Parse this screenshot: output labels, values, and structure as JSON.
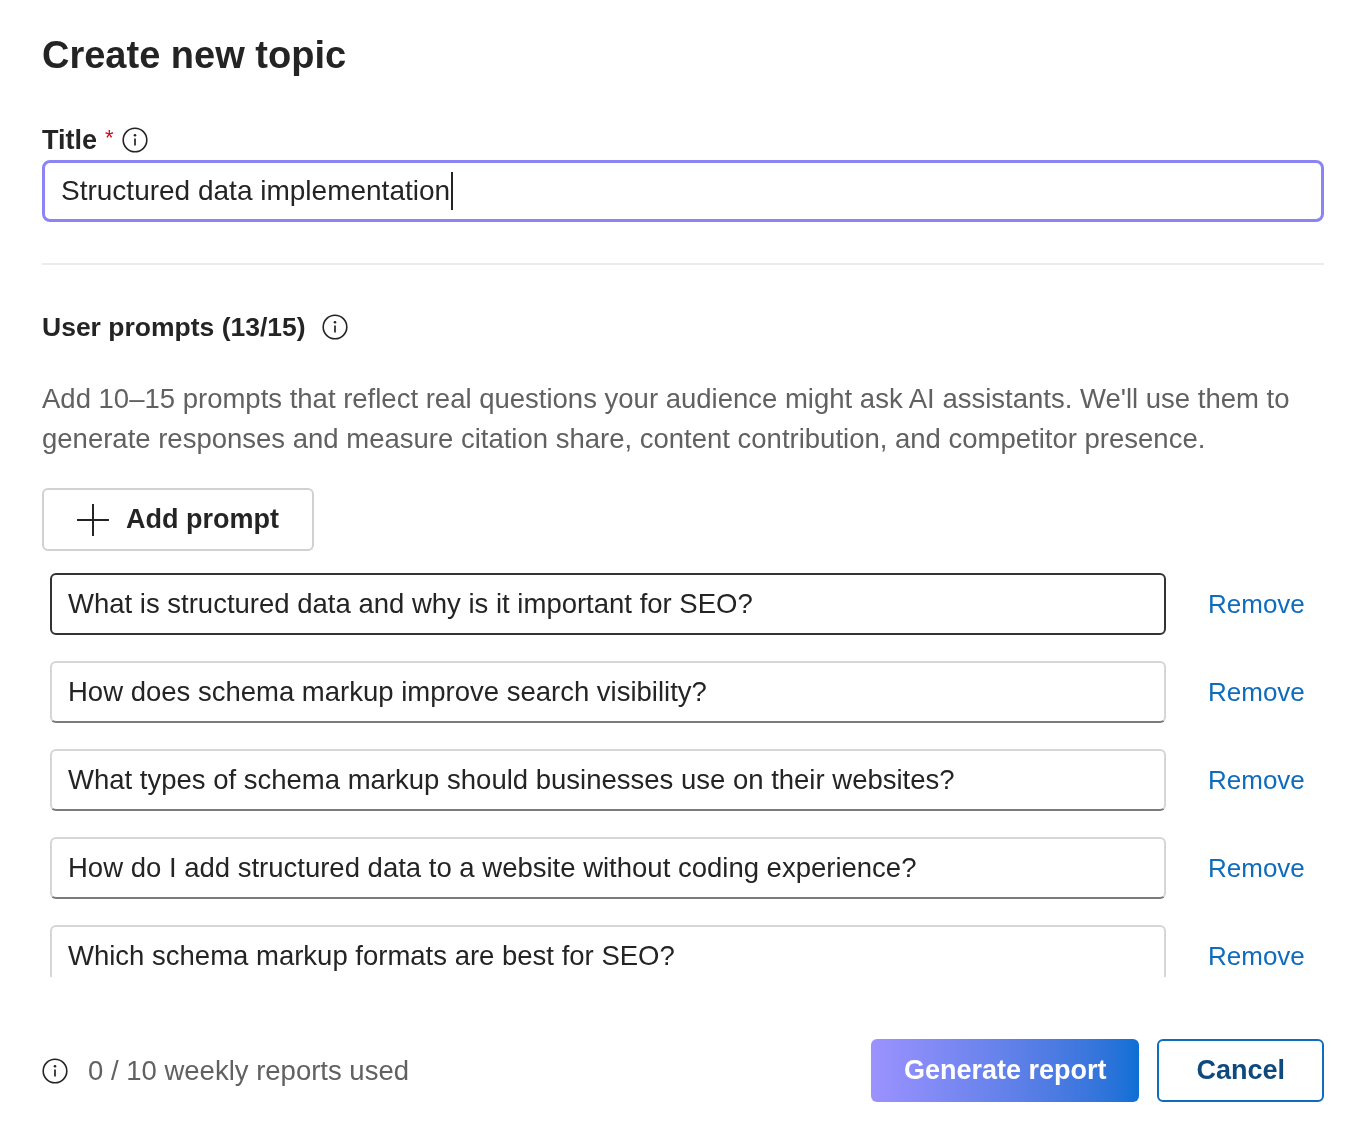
{
  "dialog": {
    "title": "Create new topic"
  },
  "title_field": {
    "label": "Title",
    "required_mark": "*",
    "value": "Structured data implementation",
    "focused": true
  },
  "prompts_section": {
    "heading": "User prompts (13/15)",
    "description": "Add 10–15 prompts that reflect real questions your audience might ask AI assistants. We'll use them to generate responses and measure citation share, content contribution, and competitor presence.",
    "add_button": {
      "label": "Add prompt"
    },
    "prompts": [
      {
        "text": "What is structured data and why is it important for SEO?",
        "hovered": true,
        "remove_label": "Remove"
      },
      {
        "text": "How does schema markup improve search visibility?",
        "hovered": false,
        "remove_label": "Remove"
      },
      {
        "text": "What types of schema markup should businesses use on their websites?",
        "hovered": false,
        "remove_label": "Remove"
      },
      {
        "text": "How do I add structured data to a website without coding experience?",
        "hovered": false,
        "remove_label": "Remove"
      },
      {
        "text": "Which schema markup formats are best for SEO?",
        "hovered": false,
        "remove_label": "Remove"
      }
    ]
  },
  "footer": {
    "usage": "0 / 10 weekly reports used",
    "buttons": [
      {
        "label": "Generate report",
        "kind": "primary"
      },
      {
        "label": "Cancel",
        "kind": "secondary"
      }
    ]
  }
}
